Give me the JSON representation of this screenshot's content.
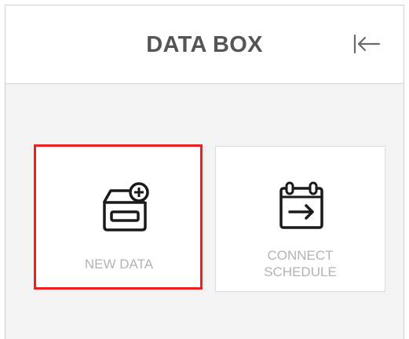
{
  "panel": {
    "title": "DATA BOX"
  },
  "header": {
    "collapse_icon": "collapse-left-icon"
  },
  "cards": [
    {
      "label": "NEW DATA",
      "icon": "new-data-box-icon",
      "selected": true
    },
    {
      "label": "CONNECT\nSCHEDULE",
      "icon": "calendar-arrow-icon",
      "selected": false
    }
  ],
  "colors": {
    "selection_outline": "#ef1e1e",
    "label_text": "#b3b3b3",
    "title_text": "#555555",
    "panel_background": "#f3f3f3"
  }
}
